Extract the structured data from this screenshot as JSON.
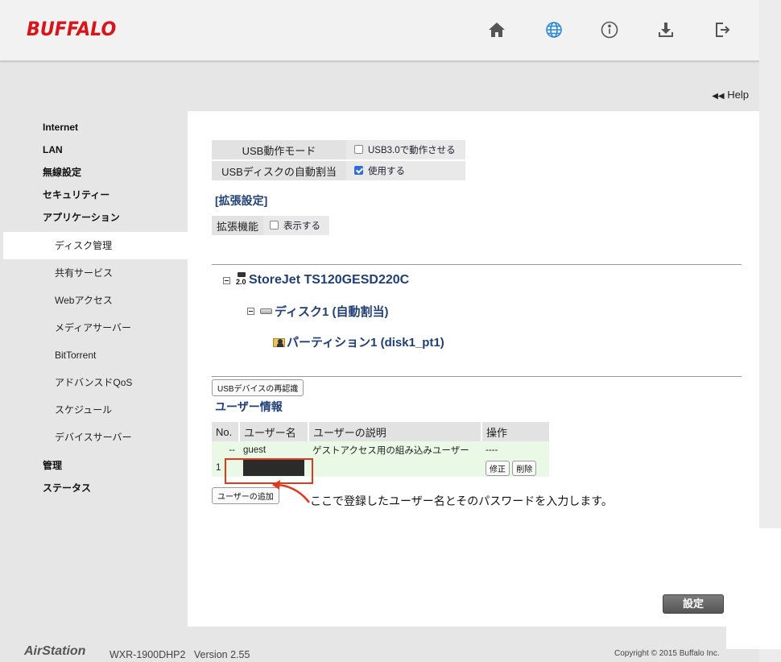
{
  "header": {
    "logo": "BUFFALO",
    "icons": [
      "home-icon",
      "globe-icon",
      "info-icon",
      "download-icon",
      "logout-icon"
    ]
  },
  "help_label": "Help",
  "sidebar": {
    "items": [
      {
        "label": "Internet"
      },
      {
        "label": "LAN"
      },
      {
        "label": "無線設定"
      },
      {
        "label": "セキュリティー"
      },
      {
        "label": "アプリケーション"
      }
    ],
    "subitems": [
      {
        "label": "ディスク管理",
        "active": true
      },
      {
        "label": "共有サービス"
      },
      {
        "label": "Webアクセス"
      },
      {
        "label": "メディアサーバー"
      },
      {
        "label": "BitTorrent"
      },
      {
        "label": "アドバンスドQoS"
      },
      {
        "label": "スケジュール"
      },
      {
        "label": "デバイスサーバー"
      }
    ],
    "bottom_items": [
      {
        "label": "管理"
      },
      {
        "label": "ステータス"
      }
    ]
  },
  "settings": {
    "usb_mode_label": "USB動作モード",
    "usb_mode_value": "USB3.0で動作させる",
    "usb_mode_checked": false,
    "auto_assign_label": "USBディスクの自動割当",
    "auto_assign_value": "使用する",
    "auto_assign_checked": true
  },
  "extended": {
    "title": "[拡張設定]",
    "label": "拡張機能",
    "value": "表示する",
    "checked": false
  },
  "tree": {
    "usb_badge": "2.0",
    "device": "StoreJet TS120GESD220C",
    "disk": "ディスク1 (自動割当)",
    "partition": "パーティション1 (disk1_pt1)"
  },
  "reconnect_button": "USBデバイスの再認識",
  "user_info": {
    "title": "ユーザー情報",
    "headers": [
      "No.",
      "ユーザー名",
      "ユーザーの説明",
      "操作"
    ],
    "rows": [
      {
        "no": "--",
        "name": "guest",
        "desc": "ゲストアクセス用の組み込みユーザー",
        "op": "----"
      },
      {
        "no": "1",
        "name": "",
        "desc": "",
        "edit": "修正",
        "delete": "削除"
      }
    ],
    "add_button": "ユーザーの追加"
  },
  "annotation": "ここで登録したユーザー名とそのパスワードを入力します。",
  "submit_button": "設定",
  "footer": {
    "brand": "AirStation",
    "model": "WXR-1900DHP2",
    "version": "Version 2.55",
    "copyright": "Copyright © 2015 Buffalo Inc."
  },
  "colors": {
    "brand_red": "#d7151a",
    "title_blue": "#1f3f75",
    "annotation_red": "#e03a1c",
    "globe_blue": "#2a8ad6"
  }
}
